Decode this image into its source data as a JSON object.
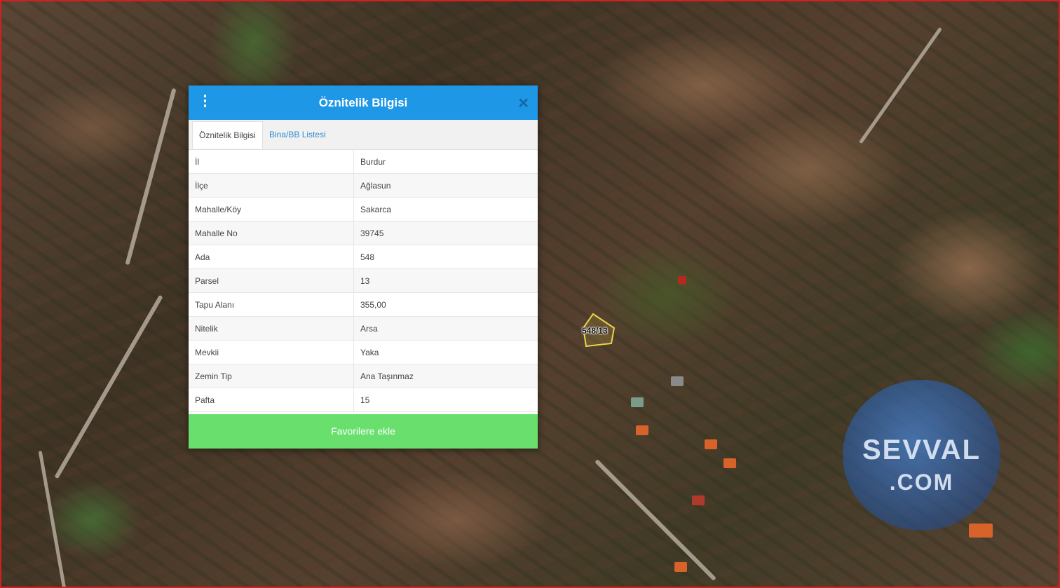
{
  "dialog": {
    "title": "Öznitelik Bilgisi",
    "tabs": [
      {
        "label": "Öznitelik Bilgisi",
        "active": true
      },
      {
        "label": "Bina/BB Listesi",
        "active": false
      }
    ],
    "rows": [
      {
        "key": "İl",
        "value": "Burdur"
      },
      {
        "key": "İlçe",
        "value": "Ağlasun"
      },
      {
        "key": "Mahalle/Köy",
        "value": "Sakarca"
      },
      {
        "key": "Mahalle No",
        "value": "39745"
      },
      {
        "key": "Ada",
        "value": "548"
      },
      {
        "key": "Parsel",
        "value": "13"
      },
      {
        "key": "Tapu Alanı",
        "value": "355,00"
      },
      {
        "key": "Nitelik",
        "value": "Arsa"
      },
      {
        "key": "Mevkii",
        "value": "Yaka"
      },
      {
        "key": "Zemin Tip",
        "value": "Ana Taşınmaz"
      },
      {
        "key": "Pafta",
        "value": "15"
      }
    ],
    "favorite_button": "Favorilere ekle",
    "menu_icon": "vertical-dots-icon",
    "close_icon": "close-icon"
  },
  "map": {
    "parcel_label": "548/13",
    "parcel_color": "#e8d64a",
    "watermark_line1": "SEVVAL",
    "watermark_line2": ".COM"
  },
  "colors": {
    "header": "#1e97e6",
    "favorite_button": "#69e06e",
    "frame_border": "#d12020"
  }
}
